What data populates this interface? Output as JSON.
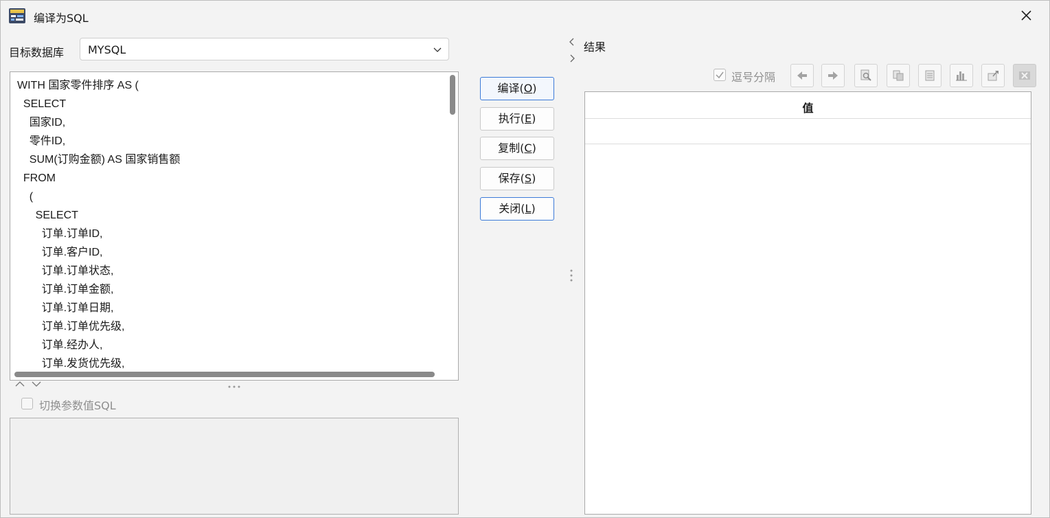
{
  "window": {
    "title": "编译为SQL"
  },
  "target_db": {
    "label": "目标数据库",
    "value": "MYSQL"
  },
  "sql_lines": [
    "WITH 国家零件排序 AS (",
    "  SELECT",
    "    国家ID,",
    "    零件ID,",
    "    SUM(订购金额) AS 国家销售额",
    "  FROM",
    "    (",
    "      SELECT",
    "        订单.订单ID,",
    "        订单.客户ID,",
    "        订单.订单状态,",
    "        订单.订单金额,",
    "        订单.订单日期,",
    "        订单.订单优先级,",
    "        订单.经办人,",
    "        订单.发货优先级,"
  ],
  "toggle_param_sql": {
    "label": "切换参数值SQL",
    "checked": false
  },
  "buttons": {
    "compile": {
      "label": "编译",
      "key": "O"
    },
    "execute": {
      "label": "执行",
      "key": "E"
    },
    "copy": {
      "label": "复制",
      "key": "C"
    },
    "save": {
      "label": "保存",
      "key": "S"
    },
    "close": {
      "label": "关闭",
      "key": "L"
    }
  },
  "result": {
    "title": "结果",
    "comma_separated": {
      "label": "逗号分隔",
      "checked": true
    },
    "toolbar_icons": [
      "arrow-left-icon",
      "arrow-right-icon",
      "find-icon",
      "copy-icon",
      "list-icon",
      "chart-icon",
      "export-icon",
      "clear-icon"
    ],
    "columns": [
      "值"
    ],
    "rows": [
      [
        ""
      ]
    ]
  },
  "colors": {
    "accent": "#3b7ad8",
    "background": "#f3f3f3",
    "grid_bg": "#ffffff"
  }
}
